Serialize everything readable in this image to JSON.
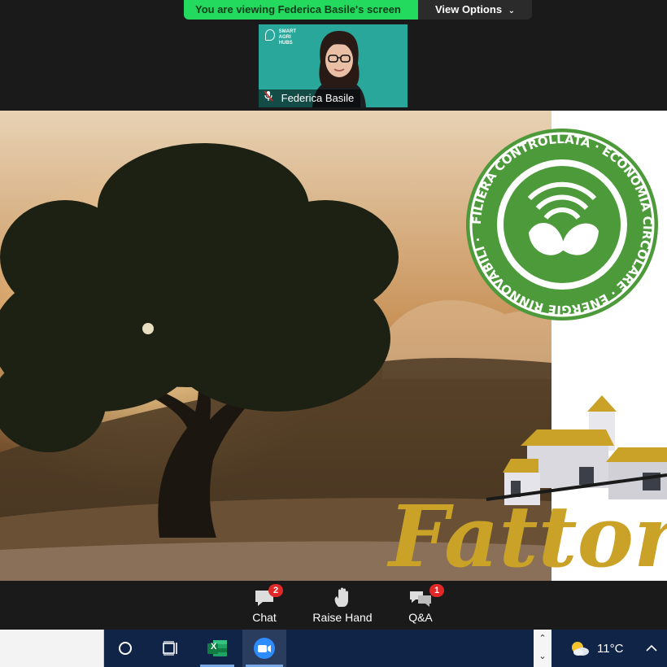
{
  "banner": {
    "viewing_text": "You are viewing Federica Basile's screen",
    "view_options_label": "View Options"
  },
  "participant": {
    "name": "Federica Basile",
    "background_logo_lines": [
      "SMART",
      "AGRI",
      "HUBS"
    ]
  },
  "shared_content": {
    "stamp_text": "FILIERA CONTROLLATA · ECONOMIA CIRCOLARE · ENERGIE RINNOVABILI ·",
    "brand_text": "Fattor"
  },
  "controls": {
    "chat": {
      "label": "Chat",
      "badge": "2"
    },
    "raise_hand": {
      "label": "Raise Hand"
    },
    "qa": {
      "label": "Q&A",
      "badge": "1"
    }
  },
  "taskbar": {
    "excel_letter": "X",
    "weather": "11°C"
  },
  "colors": {
    "banner_green": "#23d95e",
    "stamp_green": "#4c9a3a",
    "brand_gold": "#c9a227",
    "badge_red": "#e02828",
    "tile_teal": "#2aa79b",
    "taskbar_blue": "#0f2446"
  }
}
